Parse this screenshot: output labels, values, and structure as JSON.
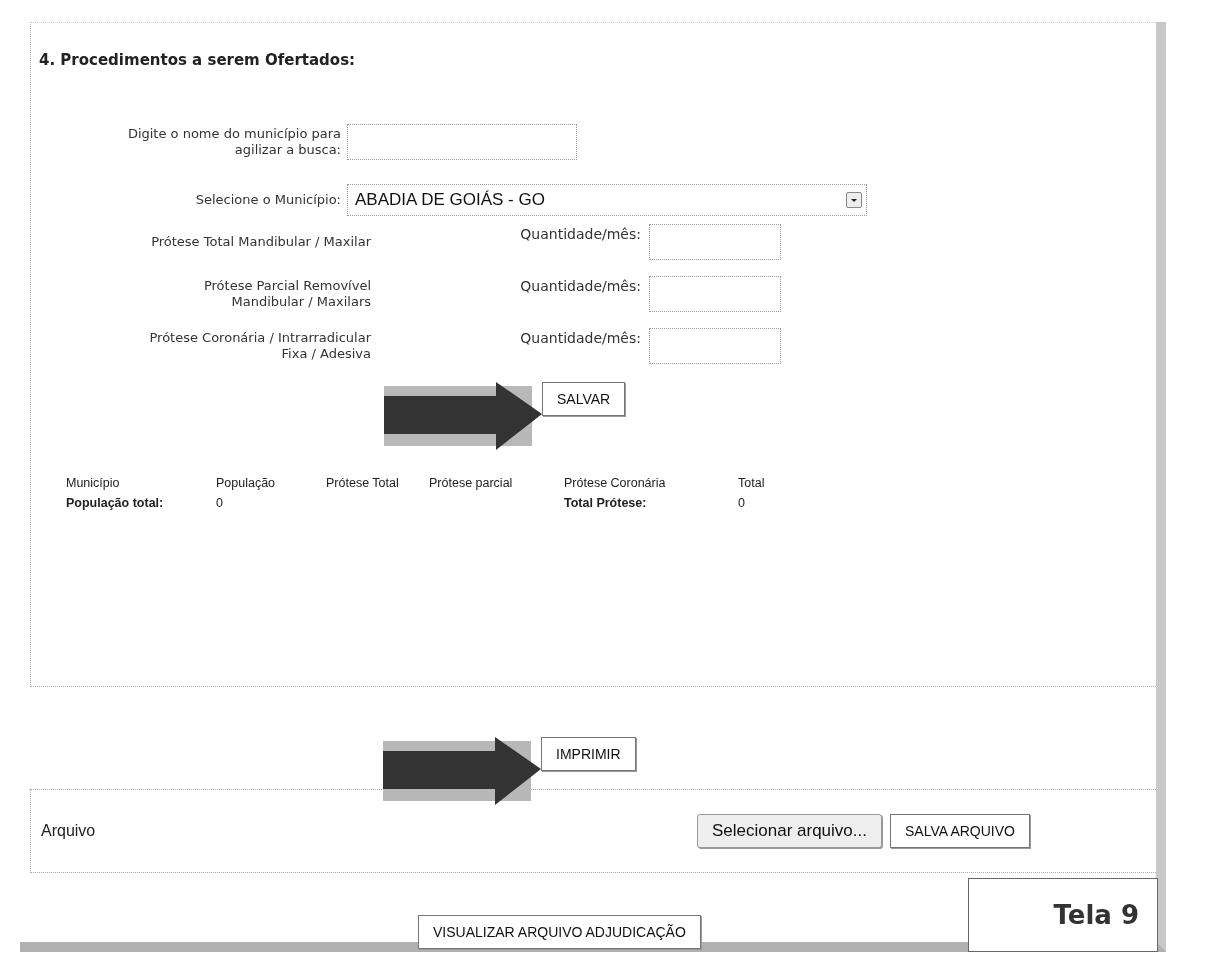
{
  "section_title": "4. Procedimentos a serem Ofertados:",
  "search": {
    "label_lines": [
      "Digite o nome do município para",
      "agilizar a busca:"
    ]
  },
  "municipality": {
    "label": "Selecione o Município:",
    "value": "ABADIA DE GOIÁS - GO"
  },
  "procedures": [
    {
      "name_lines": [
        "Prótese Total Mandibular / Maxilar"
      ],
      "quantity_label": "Quantidade/mês:"
    },
    {
      "name_lines": [
        "Prótese Parcial Removível",
        "Mandibular / Maxilars"
      ],
      "quantity_label": "Quantidade/mês:"
    },
    {
      "name_lines": [
        "Prótese Coronária / Intrarradicular",
        "Fixa / Adesiva"
      ],
      "quantity_label": "Quantidade/mês:"
    }
  ],
  "save_button": "SALVAR",
  "summary": {
    "columns": [
      "Município",
      "População",
      "Prótese Total",
      "Prótese parcial",
      "Prótese Coronária",
      "Total"
    ],
    "population_label": "População total:",
    "population_value": "0",
    "prosthesis_label": "Total Prótese:",
    "prosthesis_value": "0"
  },
  "print_button": "IMPRIMIR",
  "file": {
    "label": "Arquivo",
    "choose_button": "Selecionar arquivo...",
    "save_button": "SALVA ARQUIVO"
  },
  "view_button": "VISUALIZAR ARQUIVO ADJUDICAÇÃO",
  "caption": "Tela 9"
}
